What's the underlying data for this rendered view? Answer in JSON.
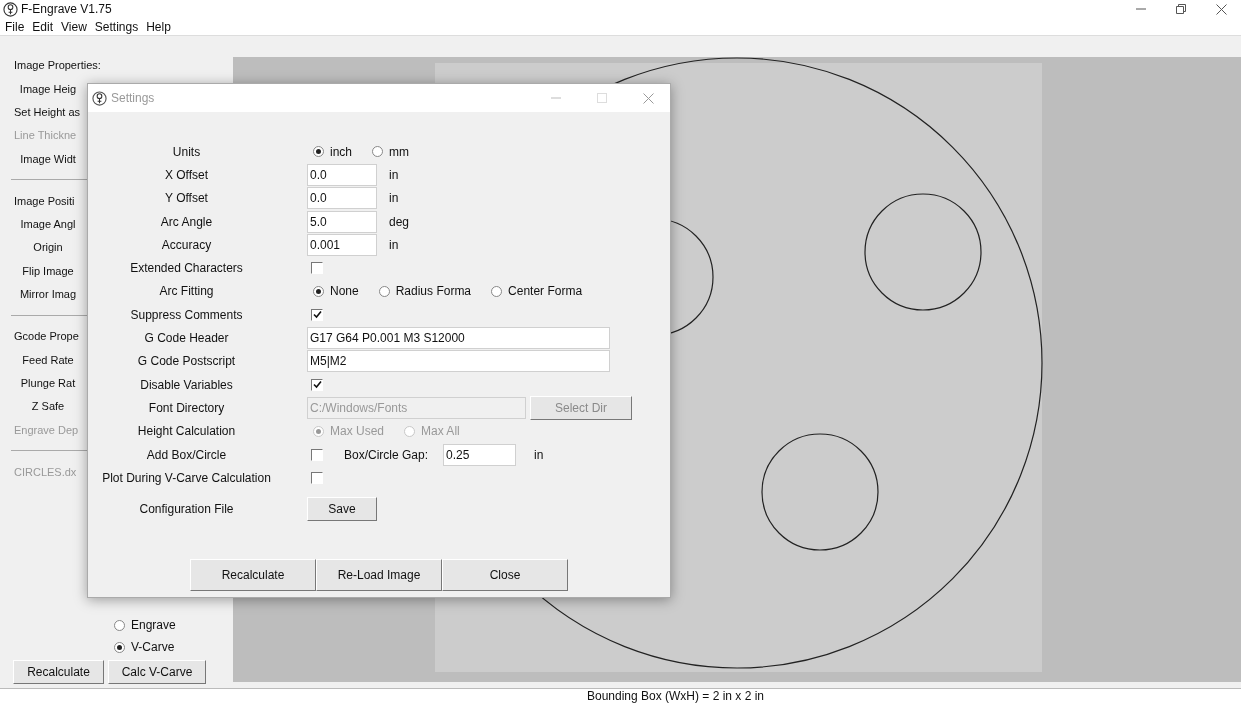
{
  "window": {
    "title": "F-Engrave V1.75"
  },
  "menu": [
    "File",
    "Edit",
    "View",
    "Settings",
    "Help"
  ],
  "left_panel": {
    "items": [
      {
        "kind": "heading",
        "text": "Image Properties:",
        "disabled": false
      },
      {
        "kind": "label",
        "text": "Image Heig",
        "disabled": false
      },
      {
        "kind": "heading",
        "text": "Set Height as",
        "disabled": false
      },
      {
        "kind": "heading",
        "text": "Line Thickne",
        "disabled": true
      },
      {
        "kind": "label",
        "text": "Image Widt",
        "disabled": false
      },
      {
        "kind": "divider"
      },
      {
        "kind": "heading",
        "text": "Image Positi",
        "disabled": false
      },
      {
        "kind": "label",
        "text": "Image Angl",
        "disabled": false
      },
      {
        "kind": "label",
        "text": "Origin",
        "disabled": false
      },
      {
        "kind": "label",
        "text": "Flip Image",
        "disabled": false
      },
      {
        "kind": "label",
        "text": "Mirror Imag",
        "disabled": false
      },
      {
        "kind": "divider"
      },
      {
        "kind": "heading",
        "text": "Gcode Prope",
        "disabled": false
      },
      {
        "kind": "label",
        "text": "Feed Rate",
        "disabled": false
      },
      {
        "kind": "label",
        "text": "Plunge Rat",
        "disabled": false
      },
      {
        "kind": "label",
        "text": "Z Safe",
        "disabled": false
      },
      {
        "kind": "heading",
        "text": "Engrave Dep",
        "disabled": true
      },
      {
        "kind": "divider"
      },
      {
        "kind": "heading",
        "text": "CIRCLES.dx",
        "disabled": true
      }
    ],
    "mode_options": [
      {
        "label": "Engrave",
        "selected": false
      },
      {
        "label": "V-Carve",
        "selected": true
      }
    ],
    "buttons": [
      "Recalculate",
      "Calc V-Carve"
    ]
  },
  "status_bar": "Bounding Box (WxH) = 2 in  x 2 in",
  "dialog": {
    "title": "Settings",
    "rows": [
      {
        "kind": "radio",
        "label": "Units",
        "disabled": false,
        "options": [
          {
            "label": "inch",
            "selected": true
          },
          {
            "label": "mm",
            "selected": false
          }
        ]
      },
      {
        "kind": "number",
        "label": "X Offset",
        "value": "0.0",
        "unit": "in"
      },
      {
        "kind": "number",
        "label": "Y Offset",
        "value": "0.0",
        "unit": "in"
      },
      {
        "kind": "number",
        "label": "Arc Angle",
        "value": "5.0",
        "unit": "deg"
      },
      {
        "kind": "number",
        "label": "Accuracy",
        "value": "0.001",
        "unit": "in"
      },
      {
        "kind": "checkbox",
        "label": "Extended Characters",
        "checked": false
      },
      {
        "kind": "radio",
        "label": "Arc Fitting",
        "disabled": false,
        "options": [
          {
            "label": "None",
            "selected": true
          },
          {
            "label": "Radius Forma",
            "selected": false
          },
          {
            "label": "Center Forma",
            "selected": false
          }
        ]
      },
      {
        "kind": "checkbox",
        "label": "Suppress Comments",
        "checked": true
      },
      {
        "kind": "text",
        "label": "G Code Header",
        "value": "G17 G64 P0.001 M3 S12000"
      },
      {
        "kind": "text",
        "label": "G Code Postscript",
        "value": "M5|M2"
      },
      {
        "kind": "checkbox",
        "label": "Disable Variables",
        "checked": true
      },
      {
        "kind": "directory",
        "label": "Font Directory",
        "value": "C:/Windows/Fonts",
        "button": "Select Dir",
        "disabled": true
      },
      {
        "kind": "radio",
        "label": "Height Calculation",
        "disabled": true,
        "options": [
          {
            "label": "Max Used",
            "selected": true
          },
          {
            "label": "Max All",
            "selected": false
          }
        ]
      },
      {
        "kind": "checkbox_gap",
        "label": "Add Box/Circle",
        "checked": false,
        "gap_label": "Box/Circle Gap:",
        "value": "0.25",
        "unit": "in"
      },
      {
        "kind": "checkbox",
        "label": "Plot During V-Carve Calculation",
        "checked": false
      },
      {
        "kind": "button",
        "label": "Configuration File",
        "button": "Save"
      }
    ],
    "buttons": [
      "Recalculate",
      "Re-Load Image",
      "Close"
    ]
  }
}
